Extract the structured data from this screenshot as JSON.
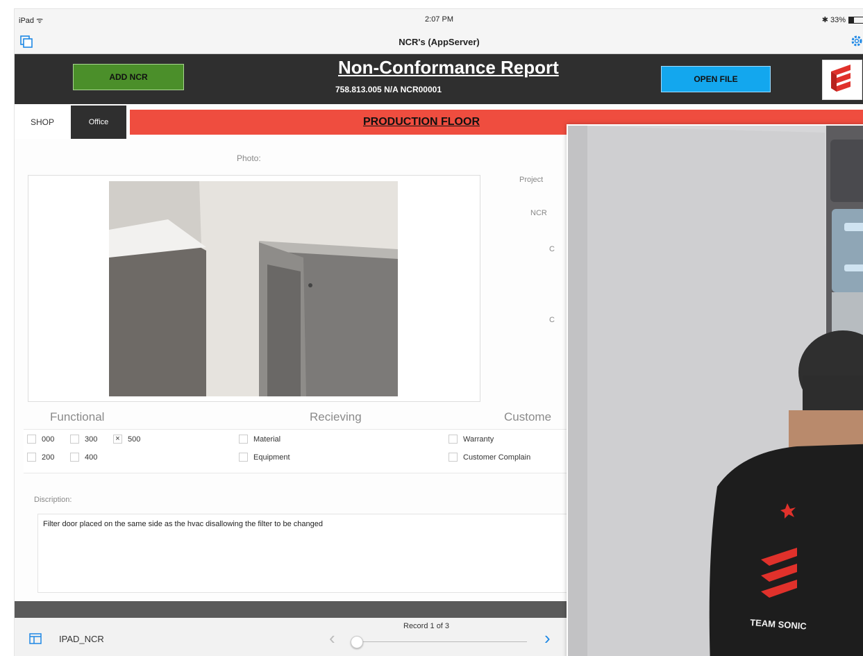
{
  "status_bar": {
    "carrier": "iPad ᯤ",
    "time": "2:07 PM",
    "battery": "✱ 33%",
    "battery_level": 0.33
  },
  "nav": {
    "title": "NCR's (AppServer)"
  },
  "header": {
    "add_button": "ADD NCR",
    "title": "Non-Conformance Report",
    "subtitle": "758.813.005 N/A NCR00001",
    "open_button": "OPEN FILE"
  },
  "tabs": [
    {
      "label": "SHOP"
    },
    {
      "label": "Office"
    }
  ],
  "production_bar": {
    "label": "PRODUCTION FLOOR"
  },
  "photo": {
    "label": "Photo:"
  },
  "side_fields": [
    {
      "label": "Project"
    },
    {
      "label": "NCR"
    },
    {
      "label": "C"
    },
    {
      "label": "C"
    }
  ],
  "categories": {
    "functional": {
      "title": "Functional",
      "options": [
        {
          "label": "000",
          "checked": false
        },
        {
          "label": "300",
          "checked": false
        },
        {
          "label": "500",
          "checked": true
        },
        {
          "label": "200",
          "checked": false
        },
        {
          "label": "400",
          "checked": false
        }
      ]
    },
    "receiving": {
      "title": "Recieving",
      "options": [
        {
          "label": "Material",
          "checked": false
        },
        {
          "label": "Equipment",
          "checked": false
        }
      ]
    },
    "customer": {
      "title": "Custome",
      "options": [
        {
          "label": "Warranty",
          "checked": false
        },
        {
          "label": "Customer Complain",
          "checked": false
        }
      ]
    }
  },
  "description": {
    "label": "Discription:",
    "text": "Filter door placed on the same side as the hvac disallowing the filter to be changed"
  },
  "bottom_bar": {
    "table_name": "IPAD_NCR",
    "record": "Record 1 of 3",
    "record_position": 0.0
  },
  "overlay_photo": {
    "shirt_text": "TEAM SONIC"
  },
  "colors": {
    "header_bg": "#2f2f2f",
    "add_button": "#4b8f2a",
    "open_button": "#13a7ee",
    "production_bar": "#ef4d3f",
    "ios_blue": "#1e88e5"
  }
}
